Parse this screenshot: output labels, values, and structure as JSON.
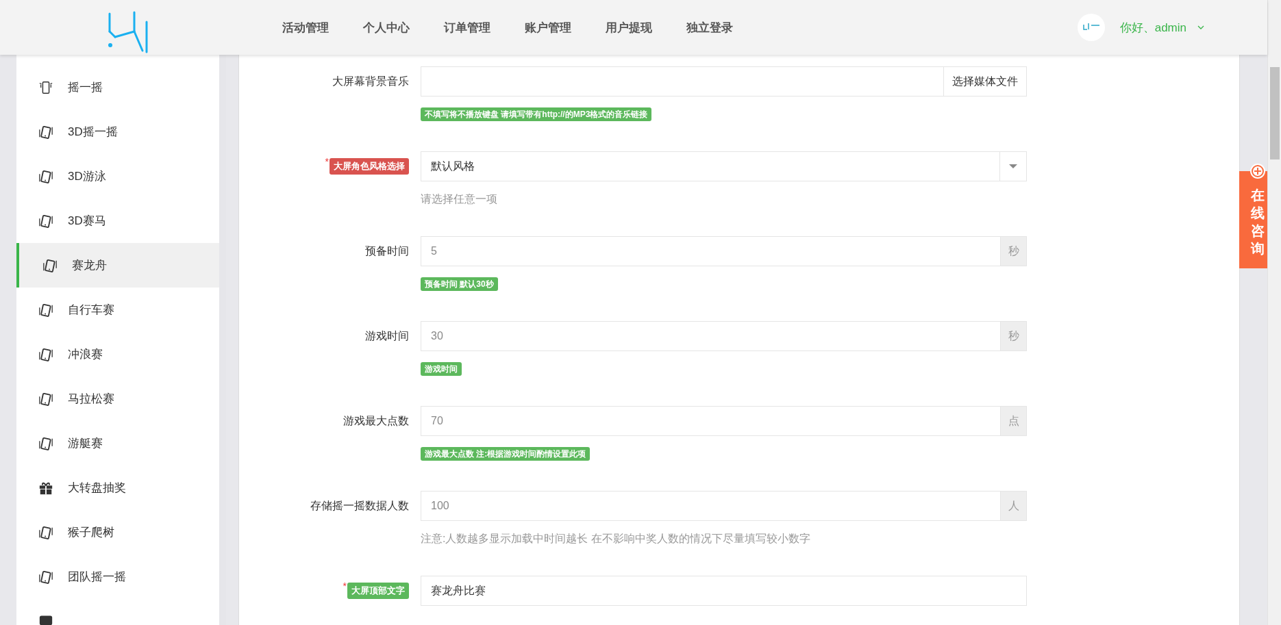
{
  "nav": {
    "items": [
      {
        "label": "活动管理"
      },
      {
        "label": "个人中心"
      },
      {
        "label": "订单管理"
      },
      {
        "label": "账户管理"
      },
      {
        "label": "用户提现"
      },
      {
        "label": "独立登录"
      }
    ]
  },
  "user": {
    "greeting": "你好、admin"
  },
  "sidebar": {
    "items": [
      {
        "label": "摇一摇",
        "kind": "shake",
        "selected": false
      },
      {
        "label": "3D摇一摇",
        "kind": "device",
        "selected": false
      },
      {
        "label": "3D游泳",
        "kind": "device",
        "selected": false
      },
      {
        "label": "3D赛马",
        "kind": "device",
        "selected": false
      },
      {
        "label": "赛龙舟",
        "kind": "device",
        "selected": true
      },
      {
        "label": "自行车赛",
        "kind": "device",
        "selected": false
      },
      {
        "label": "冲浪赛",
        "kind": "device",
        "selected": false
      },
      {
        "label": "马拉松赛",
        "kind": "device",
        "selected": false
      },
      {
        "label": "游艇赛",
        "kind": "device",
        "selected": false
      },
      {
        "label": "大转盘抽奖",
        "kind": "gift",
        "selected": false
      },
      {
        "label": "猴子爬树",
        "kind": "device",
        "selected": false
      },
      {
        "label": "团队摇一摇",
        "kind": "device",
        "selected": false
      },
      {
        "kind": "wallet",
        "selected": false
      }
    ]
  },
  "form": {
    "rows": [
      {
        "label": {
          "kind": "plain",
          "text": "大屏幕背景音乐"
        },
        "kind": "file",
        "value": "",
        "button": "选择媒体文件",
        "help": {
          "kind": "badge",
          "text": "不填写将不播放键盘 请填写带有http://的MP3格式的音乐链接"
        }
      },
      {
        "label": {
          "kind": "badge",
          "text": "大屏角色风格选择",
          "required_mark": "*",
          "color": "#d9534f"
        },
        "kind": "select",
        "value": "默认风格",
        "help": {
          "kind": "text",
          "text": "请选择任意一项"
        }
      },
      {
        "label": {
          "kind": "plain",
          "text": "预备时间"
        },
        "kind": "addon",
        "value": "5",
        "unit": "秒",
        "help": {
          "kind": "badge",
          "text": "预备时间 默认30秒"
        }
      },
      {
        "label": {
          "kind": "plain",
          "text": "游戏时间"
        },
        "kind": "addon",
        "value": "30",
        "unit": "秒",
        "help": {
          "kind": "badge",
          "text": "游戏时间"
        }
      },
      {
        "label": {
          "kind": "plain",
          "text": "游戏最大点数"
        },
        "kind": "addon",
        "value": "70",
        "unit": "点",
        "help": {
          "kind": "badge",
          "text": "游戏最大点数 注:根据游戏时间酌情设置此项"
        }
      },
      {
        "label": {
          "kind": "plain",
          "text": "存储摇一摇数据人数"
        },
        "kind": "addon",
        "value": "100",
        "unit": "人",
        "help": {
          "kind": "text",
          "text": "注意:人数越多显示加载中时间越长 在不影响中奖人数的情况下尽量填写较小数字"
        }
      },
      {
        "label": {
          "kind": "badge",
          "text": "大屏顶部文字",
          "required_mark": "*",
          "color": "#5cb85c"
        },
        "kind": "text",
        "value": "赛龙舟比赛"
      }
    ]
  },
  "consult": {
    "label": "在线咨询"
  }
}
